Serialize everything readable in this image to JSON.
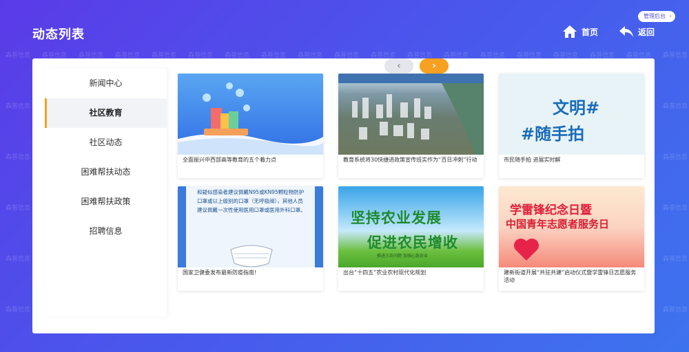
{
  "header": {
    "title": "动态列表",
    "admin_label": "管理后台",
    "home_label": "首页",
    "back_label": "返回"
  },
  "watermark": "森普信息",
  "sidebar": {
    "items": [
      {
        "label": "新闻中心",
        "active": false
      },
      {
        "label": "社区教育",
        "active": true
      },
      {
        "label": "社区动态",
        "active": false
      },
      {
        "label": "困难帮扶动态",
        "active": false
      },
      {
        "label": "困难帮扶政策",
        "active": false
      },
      {
        "label": "招聘信息",
        "active": false
      }
    ]
  },
  "cards": [
    {
      "caption": "全面振兴中西部高等教育的五个着力点",
      "image": "education-illustration"
    },
    {
      "caption": "教育系统将30快捷进政策宣传班实作为“百日冲刺”行动",
      "image": "city-aerial-photo"
    },
    {
      "caption": "市民随手拍 进展实时解",
      "image": "civilization-poster",
      "poster_line1": "文明#",
      "poster_line2": "#随手拍"
    },
    {
      "caption": "国家卫健委发布最新防疫指南!",
      "image": "mask-guideline-poster",
      "poster_text": "和疑似感染者建议佩戴N95或KN95颗粒物防护口罩或以上级别的口罩（无呼吸阀），其他人员建议佩戴一次性使用医用口罩或医用外科口罩。"
    },
    {
      "caption": "出台“十四五”农业农村现代化规划",
      "image": "agriculture-poster",
      "poster_line1": "坚持农业发展",
      "poster_line2": "促进农民增收",
      "poster_small": "推进三农问题 加强心急农业"
    },
    {
      "caption": "建新街道开展“共驻共建”启动仪式暨学雷锋日志愿服务活动",
      "image": "volunteer-poster",
      "poster_line1": "学雷锋纪念日暨",
      "poster_line2": "中国青年志愿者服务日"
    }
  ],
  "pager": {
    "prev": "‹",
    "next": "›"
  },
  "colors": {
    "accent": "#f7a021",
    "bg_start": "#5b3be8",
    "bg_end": "#3d73ee"
  }
}
